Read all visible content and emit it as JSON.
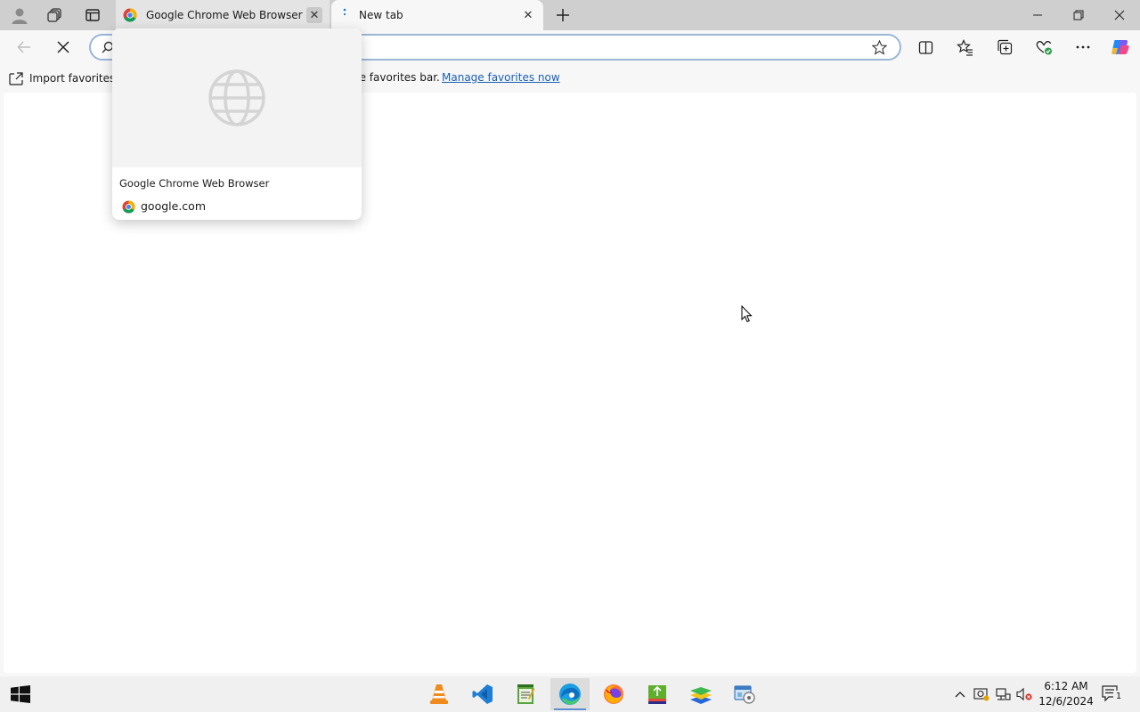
{
  "tabs": [
    {
      "title": "Google Chrome Web Browser",
      "favicon": "chrome-icon",
      "state": "inactive"
    },
    {
      "title": "New tab",
      "favicon": "loading-dots-icon",
      "state": "active"
    }
  ],
  "toolbar": {
    "omnibox_value": "",
    "omnibox_placeholder": ""
  },
  "favorites_bar": {
    "import_label": "Import favorites",
    "message": "he favorites bar.",
    "manage_link": "Manage favorites now"
  },
  "hover_card": {
    "title": "Google Chrome Web Browser",
    "domain": "google.com"
  },
  "taskbar": {
    "apps": [
      "vlc-icon",
      "vscode-icon",
      "notepad-icon",
      "edge-icon",
      "firefox-icon",
      "book-icon",
      "bluestacks-icon",
      "control-panel-icon"
    ],
    "active_app": "edge-icon",
    "time": "6:12 AM",
    "date": "12/6/2024",
    "notification_count": "1"
  },
  "colors": {
    "tabstrip": "#cfcfcf",
    "toolbar": "#f7f7f7",
    "link": "#1a5fb4",
    "omnibox_border": "#9bb6d8"
  }
}
